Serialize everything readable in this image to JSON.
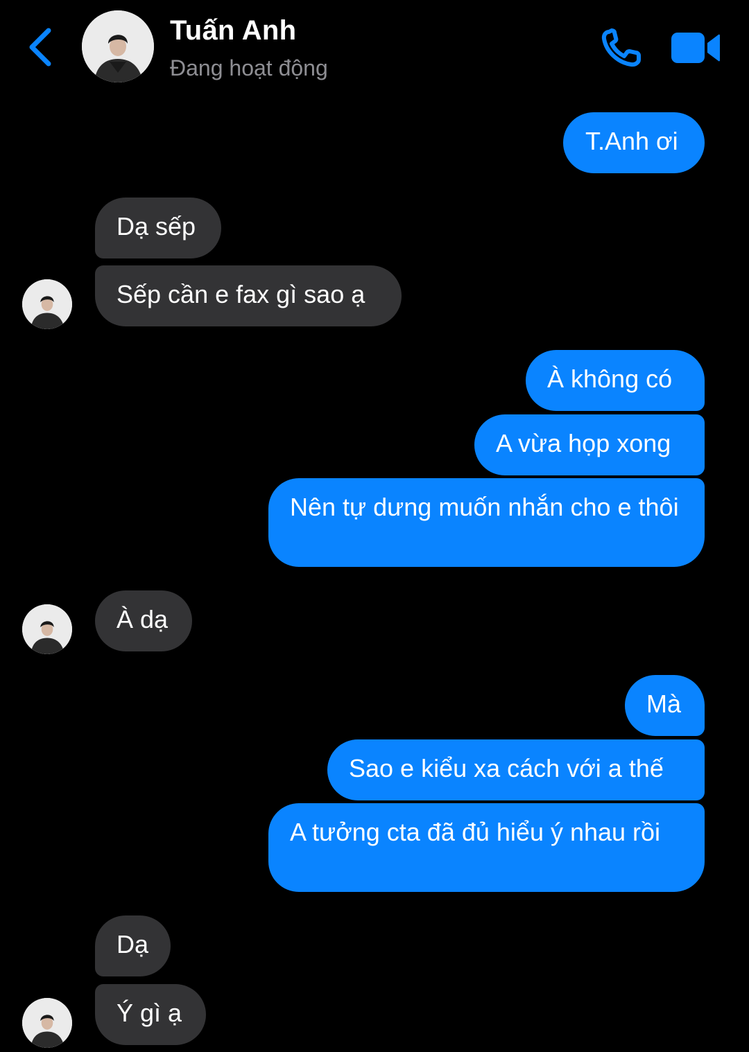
{
  "header": {
    "contact_name": "Tuấn Anh",
    "status": "Đang hoạt động",
    "back_icon": "chevron-left-icon",
    "call_icon": "phone-icon",
    "video_icon": "video-camera-icon",
    "accent_color": "#0A84FF"
  },
  "messages": [
    {
      "sender": "me",
      "text": "T.Anh ơi"
    },
    {
      "sender": "them",
      "text": "Dạ sếp"
    },
    {
      "sender": "them",
      "text": "Sếp cần e fax gì sao ạ"
    },
    {
      "sender": "me",
      "text": "À không có"
    },
    {
      "sender": "me",
      "text": "A vừa họp xong"
    },
    {
      "sender": "me",
      "text": "Nên tự dưng muốn nhắn cho e thôi"
    },
    {
      "sender": "them",
      "text": "À dạ"
    },
    {
      "sender": "me",
      "text": "Mà"
    },
    {
      "sender": "me",
      "text": "Sao e kiểu xa cách với a thế"
    },
    {
      "sender": "me",
      "text": "A tưởng cta đã đủ hiểu ý nhau rồi"
    },
    {
      "sender": "them",
      "text": "Dạ"
    },
    {
      "sender": "them",
      "text": "Ý gì ạ"
    }
  ],
  "colors": {
    "outgoing_bubble": "#0A84FF",
    "incoming_bubble": "#333335",
    "background": "#000000",
    "status_text": "#8E8E93"
  }
}
